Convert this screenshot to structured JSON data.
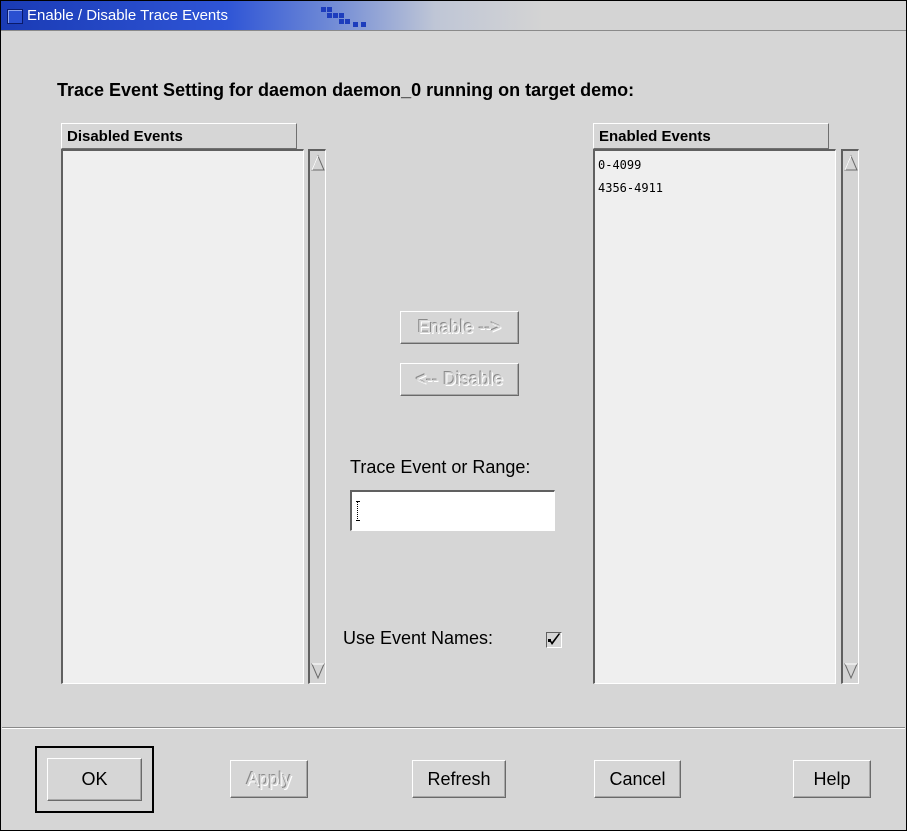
{
  "window": {
    "title": "Enable / Disable Trace Events"
  },
  "heading": "Trace Event Setting for daemon daemon_0 running on target demo:",
  "disabled_list": {
    "header": "Disabled Events",
    "items": []
  },
  "enabled_list": {
    "header": "Enabled Events",
    "items": [
      "0-4099",
      "4356-4911"
    ]
  },
  "buttons": {
    "enable": "Enable -->",
    "disable": "<-- Disable",
    "ok": "OK",
    "apply": "Apply",
    "refresh": "Refresh",
    "cancel": "Cancel",
    "help": "Help"
  },
  "range_field": {
    "label": "Trace Event or Range:",
    "value": ""
  },
  "use_event_names": {
    "label": "Use Event Names:",
    "checked": true
  },
  "icons": {
    "window": "window-icon",
    "scroll_up": "scroll-up-arrow-icon",
    "scroll_down": "scroll-down-arrow-icon",
    "check": "checkmark-icon"
  },
  "colors": {
    "titlebar": "#1a3bb5",
    "background": "#d6d6d6",
    "list_bg": "#efefef"
  }
}
